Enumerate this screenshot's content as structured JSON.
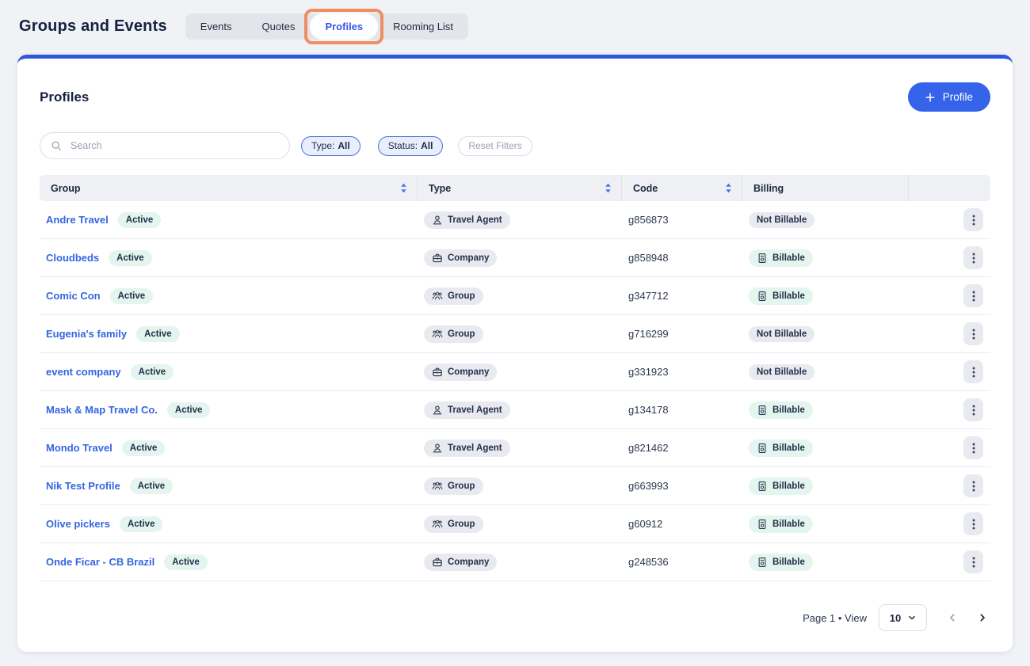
{
  "page": {
    "title": "Groups and Events",
    "tabs": [
      {
        "label": "Events",
        "active": false,
        "highlighted": false
      },
      {
        "label": "Quotes",
        "active": false,
        "highlighted": false
      },
      {
        "label": "Profiles",
        "active": true,
        "highlighted": true
      },
      {
        "label": "Rooming List",
        "active": false,
        "highlighted": false
      }
    ]
  },
  "panel": {
    "title": "Profiles",
    "add_button_label": "Profile",
    "search_placeholder": "Search",
    "filters": {
      "type": {
        "label": "Type:",
        "value": "All"
      },
      "status": {
        "label": "Status:",
        "value": "All"
      },
      "reset_label": "Reset Filters"
    }
  },
  "table": {
    "columns": [
      {
        "label": "Group",
        "sortable": true
      },
      {
        "label": "Type",
        "sortable": true
      },
      {
        "label": "Code",
        "sortable": true
      },
      {
        "label": "Billing",
        "sortable": false
      },
      {
        "label": "",
        "sortable": false
      }
    ],
    "rows": [
      {
        "group": "Andre Travel",
        "status": "Active",
        "type": "Travel Agent",
        "code": "g856873",
        "billing": "Not Billable"
      },
      {
        "group": "Cloudbeds",
        "status": "Active",
        "type": "Company",
        "code": "g858948",
        "billing": "Billable"
      },
      {
        "group": "Comic Con",
        "status": "Active",
        "type": "Group",
        "code": "g347712",
        "billing": "Billable"
      },
      {
        "group": "Eugenia's family",
        "status": "Active",
        "type": "Group",
        "code": "g716299",
        "billing": "Not Billable"
      },
      {
        "group": "event company",
        "status": "Active",
        "type": "Company",
        "code": "g331923",
        "billing": "Not Billable"
      },
      {
        "group": "Mask & Map Travel Co.",
        "status": "Active",
        "type": "Travel Agent",
        "code": "g134178",
        "billing": "Billable"
      },
      {
        "group": "Mondo Travel",
        "status": "Active",
        "type": "Travel Agent",
        "code": "g821462",
        "billing": "Billable"
      },
      {
        "group": "Nik Test Profile",
        "status": "Active",
        "type": "Group",
        "code": "g663993",
        "billing": "Billable"
      },
      {
        "group": "Olive pickers",
        "status": "Active",
        "type": "Group",
        "code": "g60912",
        "billing": "Billable"
      },
      {
        "group": "Onde Ficar - CB Brazil",
        "status": "Active",
        "type": "Company",
        "code": "g248536",
        "billing": "Billable"
      }
    ],
    "billable_label": "Billable"
  },
  "pagination": {
    "label": "Page 1 • View",
    "page_size": "10"
  },
  "colors": {
    "accent_blue": "#3563E9",
    "card_top_border": "#3056DC",
    "link_blue": "#3465E2",
    "active_tab_text": "#3657E8",
    "highlight_orange": "#EF8E62",
    "mint_badge_bg": "#E3F5EE",
    "gray_badge_bg": "#E8EAEF",
    "table_header_bg": "#EEF0F4",
    "page_bg": "#F0F2F6",
    "navy_text": "#16213F"
  },
  "icons": {
    "add": "plus-icon",
    "search": "search-icon",
    "sort": "sort-icon",
    "travel_agent": "travel-agent-icon",
    "company": "company-icon",
    "group": "group-icon",
    "billable": "billable-icon",
    "row_menu": "kebab-icon",
    "prev": "chevron-left-icon",
    "next": "chevron-right-icon",
    "select": "chevron-down-icon"
  }
}
